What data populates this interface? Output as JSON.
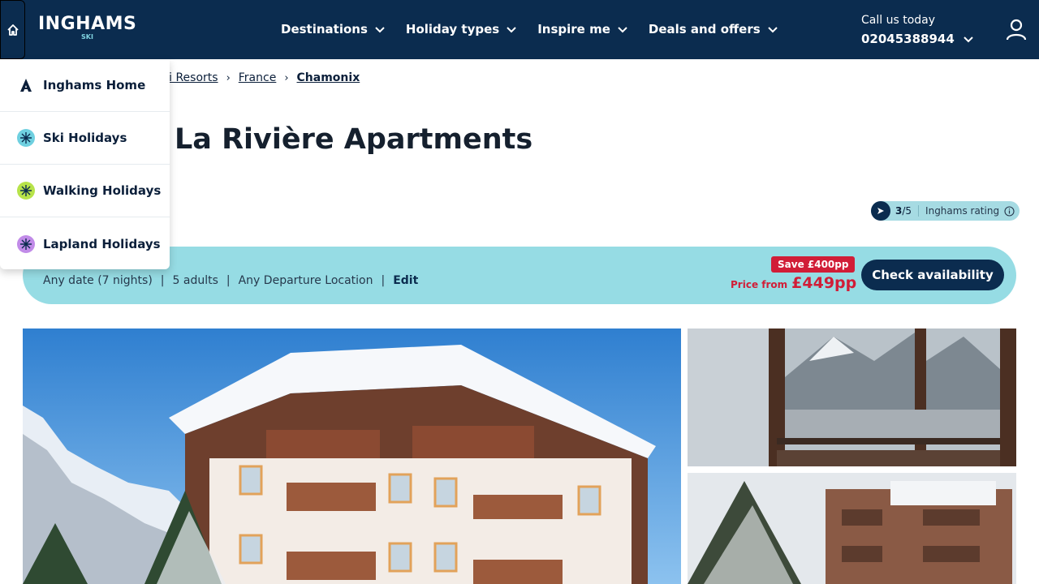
{
  "header": {
    "brand": "INGHAMS",
    "brand_sub": "SKI",
    "nav": [
      {
        "label": "Destinations"
      },
      {
        "label": "Holiday types"
      },
      {
        "label": "Inspire me"
      },
      {
        "label": "Deals and offers"
      }
    ],
    "call_label": "Call us today",
    "phone": "02045388944"
  },
  "dropdown": {
    "items": [
      {
        "label": "Inghams Home",
        "icon": "inghams-logo-icon",
        "color": "#0b1f3a"
      },
      {
        "label": "Ski Holidays",
        "icon": "snowflake-icon",
        "color": "#6fd0e0"
      },
      {
        "label": "Walking Holidays",
        "icon": "walking-icon",
        "color": "#b7e34a"
      },
      {
        "label": "Lapland Holidays",
        "icon": "lapland-icon",
        "color": "#c18be8"
      }
    ]
  },
  "breadcrumb": [
    "ki Resorts",
    "France",
    "Chamonix"
  ],
  "page_title": "La Rivière Apartments",
  "rating": {
    "score": "3",
    "out_of": "/5",
    "label": "Inghams rating"
  },
  "search": {
    "dates": "Any date (7 nights)",
    "guests": "5 adults",
    "departure": "Any Departure Location",
    "edit_label": "Edit",
    "save_badge": "Save £400pp",
    "price_from_label": "Price from",
    "price": "£449pp",
    "cta": "Check availability"
  },
  "colors": {
    "navy": "#0b2c4f",
    "aqua": "#96dce4",
    "red": "#d11d37"
  }
}
